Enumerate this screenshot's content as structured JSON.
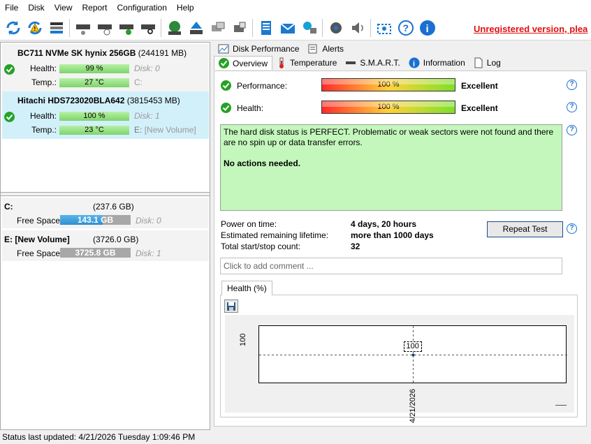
{
  "menu": [
    "File",
    "Disk",
    "View",
    "Report",
    "Configuration",
    "Help"
  ],
  "toolbar": {
    "unregistered": "Unregistered version, plea"
  },
  "disks": [
    {
      "name": "BC711 NVMe SK hynix 256GB",
      "size": "(244191 MB)",
      "health_label": "Health:",
      "health": "99 %",
      "health_pct": 99,
      "disk_label": "Disk: 0",
      "temp_label": "Temp.:",
      "temp": "27 °C",
      "letter": "C:"
    },
    {
      "name": "Hitachi HDS723020BLA642",
      "size": "(3815453 MB)",
      "health_label": "Health:",
      "health": "100 %",
      "health_pct": 100,
      "disk_label": "Disk: 1",
      "temp_label": "Temp.:",
      "temp": "23 °C",
      "letter_bold": "E:",
      "letter_rest": "[New Volume]"
    }
  ],
  "volumes": [
    {
      "name": "C:",
      "size": "(237.6 GB)",
      "free_label": "Free Space",
      "free": "143.1 GB",
      "free_fraction": 0.6,
      "disk": "Disk: 0"
    },
    {
      "name": "E: [New Volume]",
      "size": "(3726.0 GB)",
      "free_label": "Free Space",
      "free": "3725.8 GB",
      "free_fraction": 0.0,
      "disk": "Disk: 1"
    }
  ],
  "tabs_top": [
    "Disk Performance",
    "Alerts"
  ],
  "tabs": [
    "Overview",
    "Temperature",
    "S.M.A.R.T.",
    "Information",
    "Log"
  ],
  "overview": {
    "performance_label": "Performance:",
    "performance_value": "100 %",
    "performance_rating": "Excellent",
    "health_label": "Health:",
    "health_value": "100 %",
    "health_rating": "Excellent",
    "status_line1": "The hard disk status is PERFECT. Problematic or weak sectors were not found and there are no spin up or data transfer errors.",
    "status_line2": "No actions needed.",
    "power_on_label": "Power on time:",
    "power_on": "4 days, 20 hours",
    "lifetime_label": "Estimated remaining lifetime:",
    "lifetime": "more than 1000 days",
    "startstop_label": "Total start/stop count:",
    "startstop": "32",
    "repeat_button": "Repeat Test",
    "comment_placeholder": "Click to add comment ..."
  },
  "chart_data": {
    "type": "scatter",
    "tab": "Health (%)",
    "x": [
      "4/21/2026"
    ],
    "series": [
      {
        "values": [
          100
        ]
      }
    ],
    "ylabel": "100",
    "data_label": "100",
    "grid": false
  },
  "statusbar": "Status last updated: 4/21/2026 Tuesday 1:09:46 PM",
  "colors": {
    "accent": "#1a6fd1",
    "ok": "#26a126",
    "status_bg": "#c4f7bc",
    "unregistered": "#e01010"
  }
}
